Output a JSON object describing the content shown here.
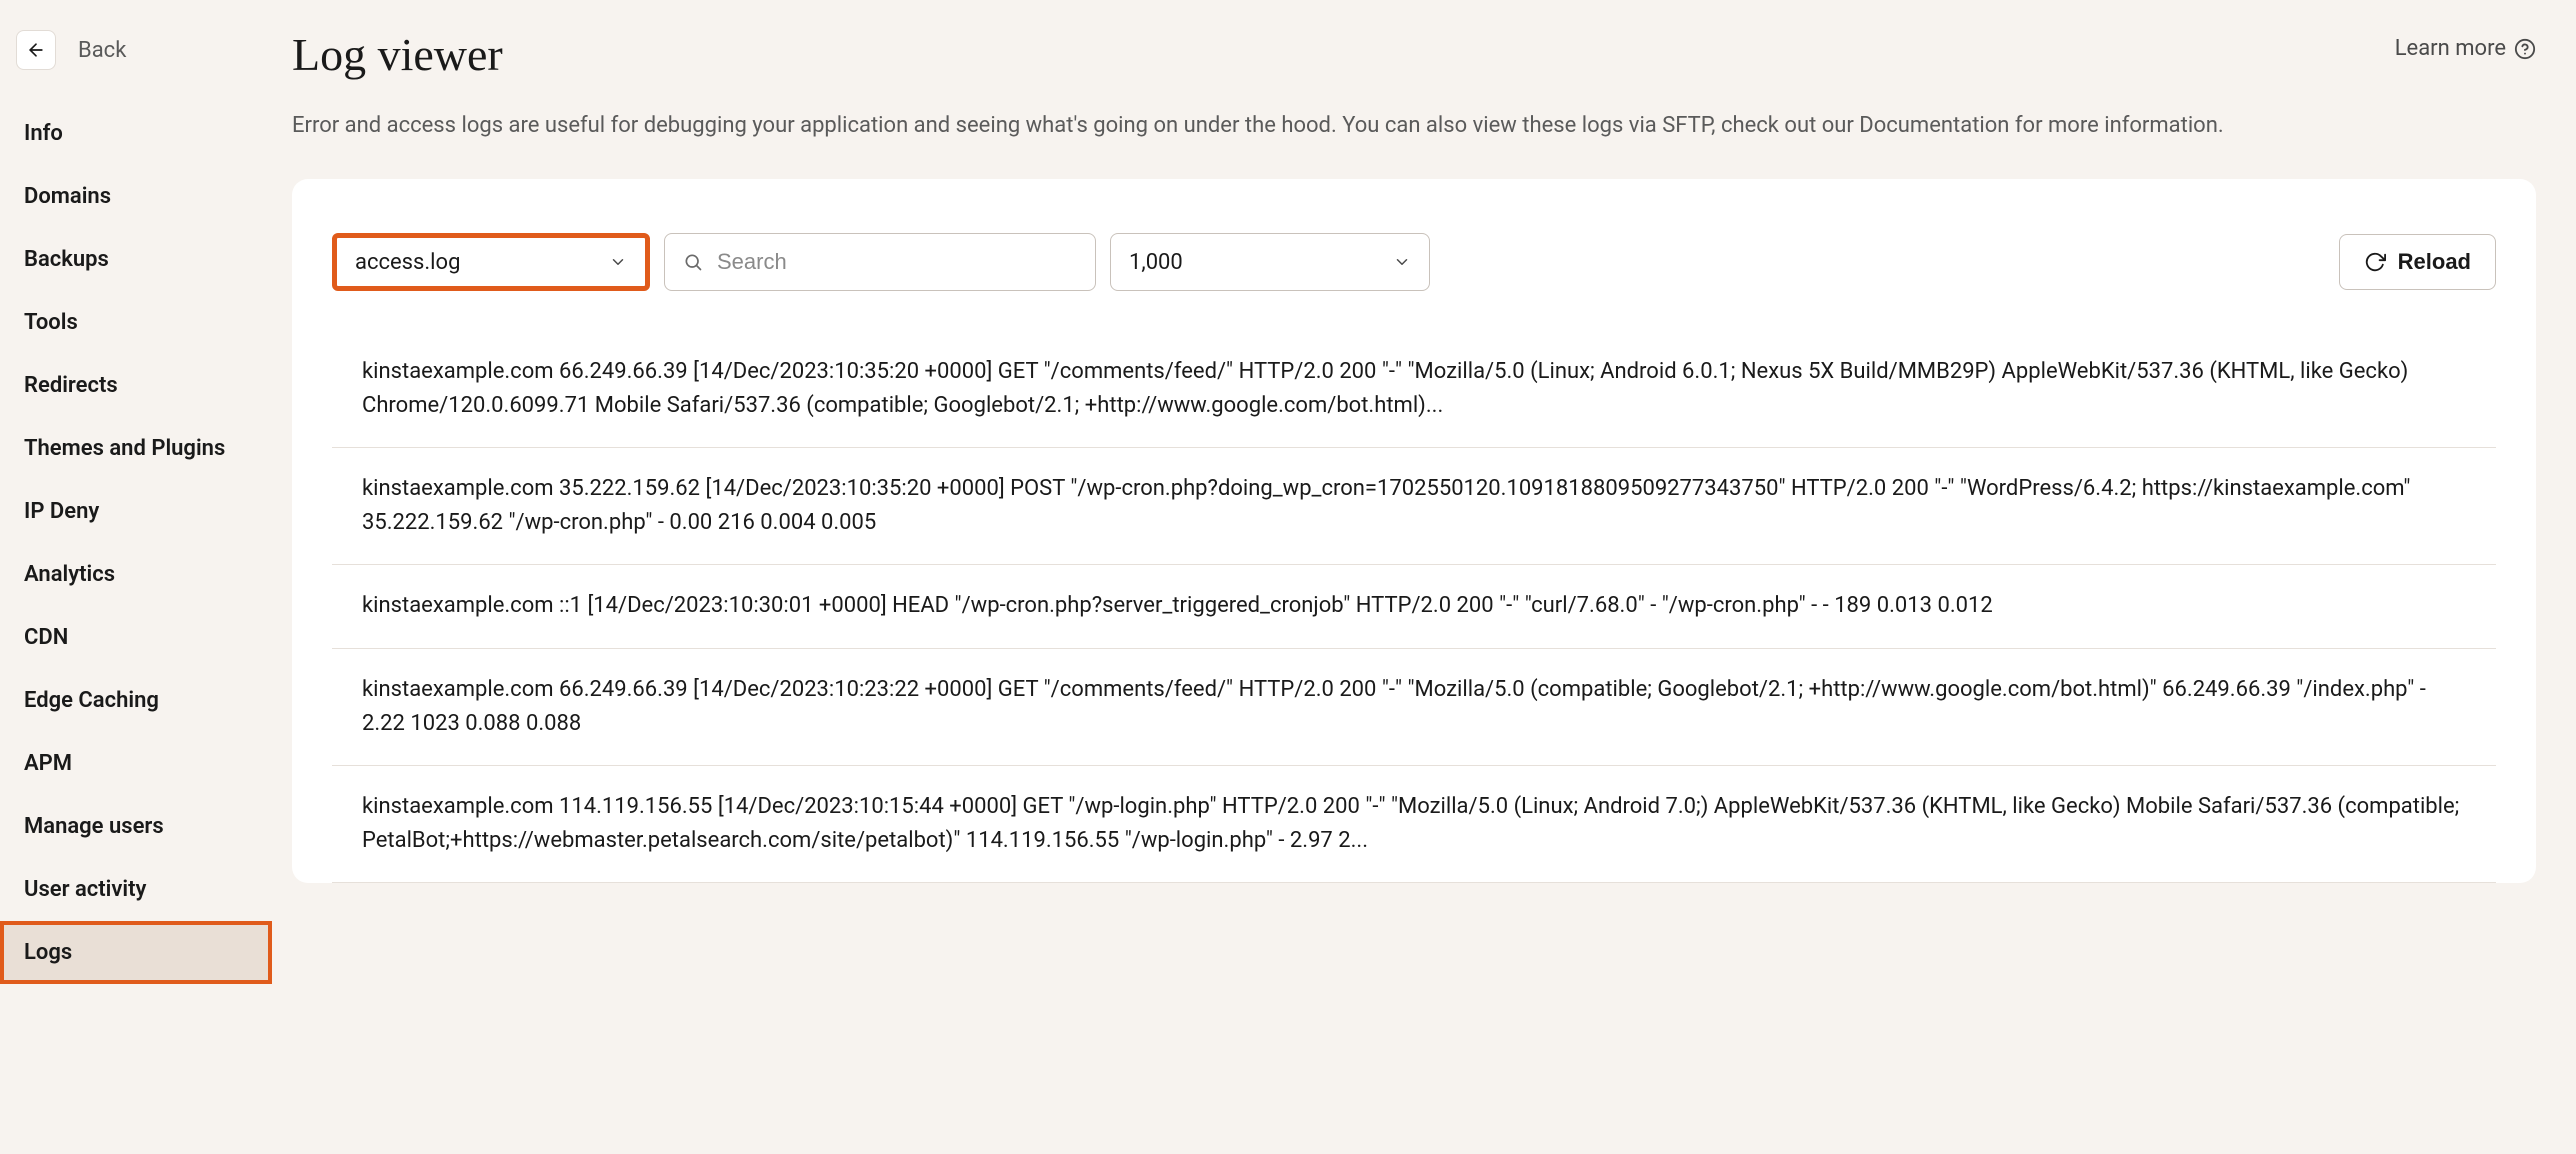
{
  "sidebar": {
    "back_label": "Back",
    "items": [
      {
        "label": "Info"
      },
      {
        "label": "Domains"
      },
      {
        "label": "Backups"
      },
      {
        "label": "Tools"
      },
      {
        "label": "Redirects"
      },
      {
        "label": "Themes and Plugins"
      },
      {
        "label": "IP Deny"
      },
      {
        "label": "Analytics"
      },
      {
        "label": "CDN"
      },
      {
        "label": "Edge Caching"
      },
      {
        "label": "APM"
      },
      {
        "label": "Manage users"
      },
      {
        "label": "User activity"
      },
      {
        "label": "Logs"
      }
    ],
    "active_index": 13
  },
  "header": {
    "title": "Log viewer",
    "learn_more": "Learn more"
  },
  "description": "Error and access logs are useful for debugging your application and seeing what's going on under the hood. You can also view these logs via SFTP, check out our Documentation for more information.",
  "controls": {
    "log_file": "access.log",
    "search_placeholder": "Search",
    "count": "1,000",
    "reload_label": "Reload"
  },
  "logs": [
    "kinstaexample.com 66.249.66.39 [14/Dec/2023:10:35:20 +0000] GET \"/comments/feed/\" HTTP/2.0 200 \"-\" \"Mozilla/5.0 (Linux; Android 6.0.1; Nexus 5X Build/MMB29P) AppleWebKit/537.36 (KHTML, like Gecko) Chrome/120.0.6099.71 Mobile Safari/537.36 (compatible; Googlebot/2.1; +http://www.google.com/bot.html)...",
    "kinstaexample.com 35.222.159.62 [14/Dec/2023:10:35:20 +0000] POST \"/wp-cron.php?doing_wp_cron=1702550120.1091818809509277343750\" HTTP/2.0 200 \"-\" \"WordPress/6.4.2; https://kinstaexample.com\" 35.222.159.62 \"/wp-cron.php\" - 0.00 216 0.004 0.005",
    "kinstaexample.com ::1 [14/Dec/2023:10:30:01 +0000] HEAD \"/wp-cron.php?server_triggered_cronjob\" HTTP/2.0 200 \"-\" \"curl/7.68.0\" - \"/wp-cron.php\" - - 189 0.013 0.012",
    "kinstaexample.com 66.249.66.39 [14/Dec/2023:10:23:22 +0000] GET \"/comments/feed/\" HTTP/2.0 200 \"-\" \"Mozilla/5.0 (compatible; Googlebot/2.1; +http://www.google.com/bot.html)\" 66.249.66.39 \"/index.php\" - 2.22 1023 0.088 0.088",
    "kinstaexample.com 114.119.156.55 [14/Dec/2023:10:15:44 +0000] GET \"/wp-login.php\" HTTP/2.0 200 \"-\" \"Mozilla/5.0 (Linux; Android 7.0;) AppleWebKit/537.36 (KHTML, like Gecko) Mobile Safari/537.36 (compatible; PetalBot;+https://webmaster.petalsearch.com/site/petalbot)\" 114.119.156.55 \"/wp-login.php\" - 2.97 2..."
  ]
}
